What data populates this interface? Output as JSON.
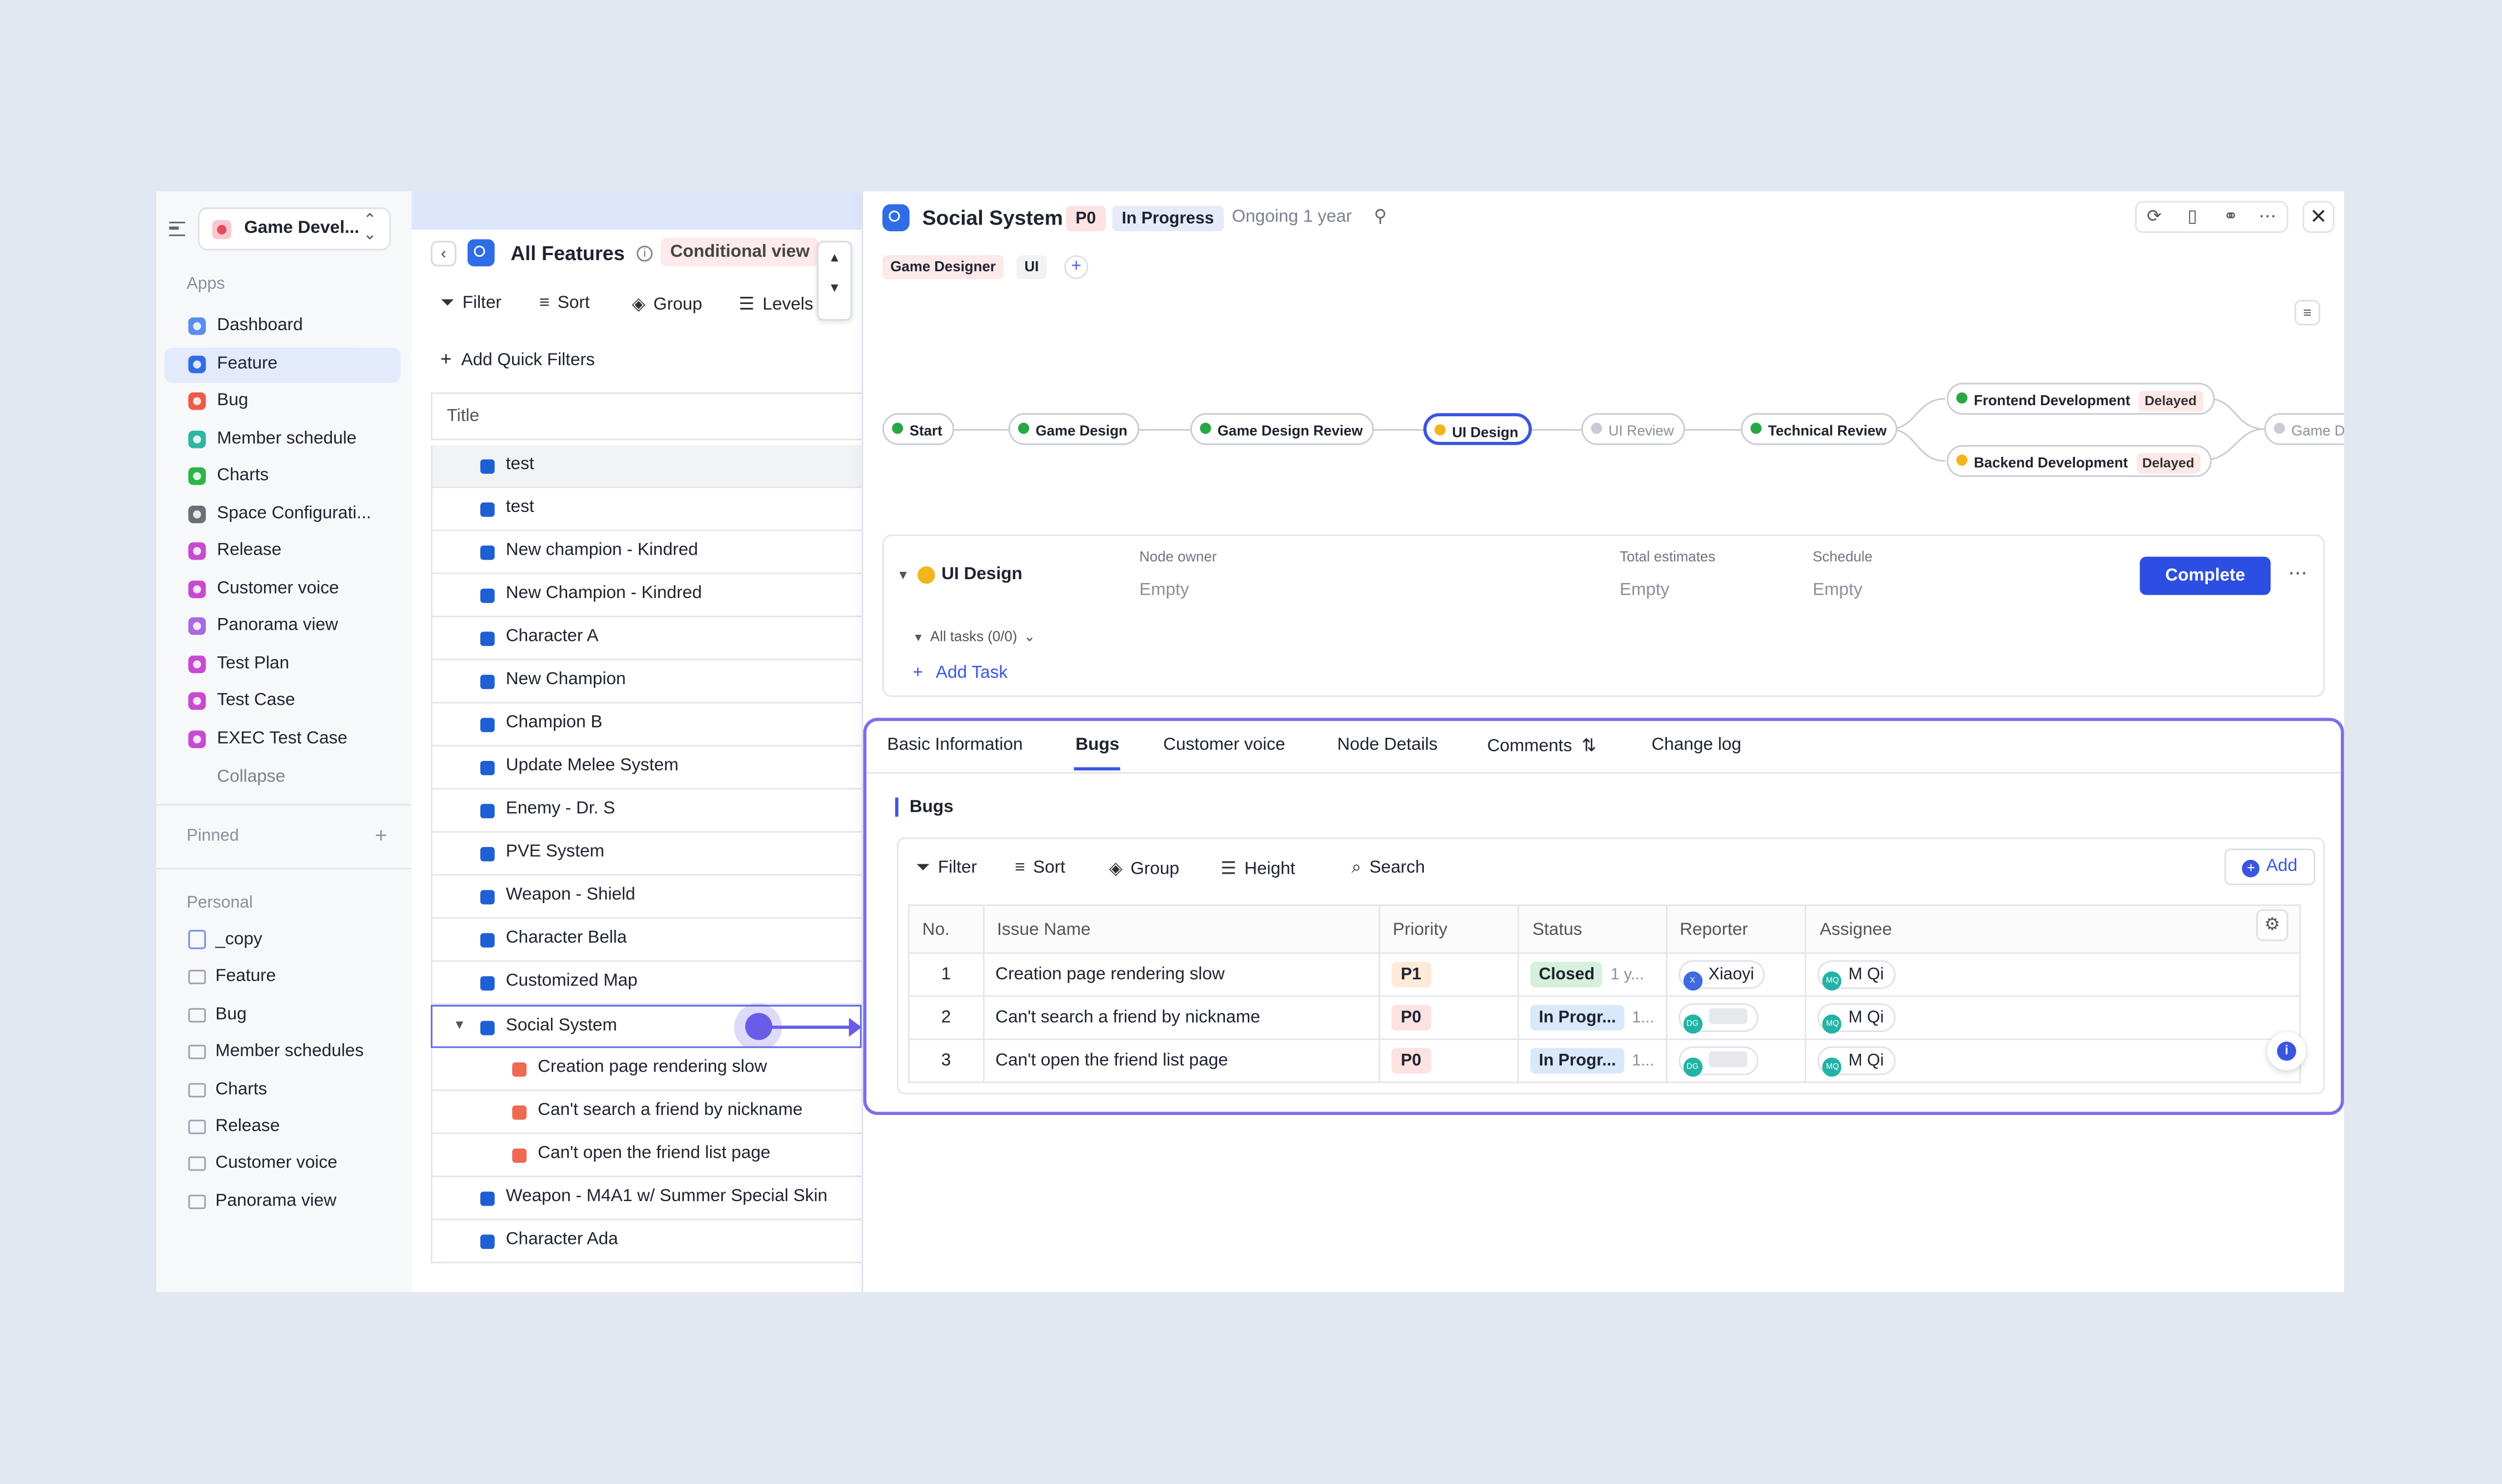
{
  "workspace": {
    "name": "Game Devel..."
  },
  "sidebar": {
    "apps_title": "Apps",
    "apps": [
      {
        "label": "Dashboard",
        "color": "#5b8def"
      },
      {
        "label": "Feature",
        "color": "#2f6de6",
        "active": true
      },
      {
        "label": "Bug",
        "color": "#ee5a4a"
      },
      {
        "label": "Member schedule",
        "color": "#2fb6a3"
      },
      {
        "label": "Charts",
        "color": "#2fb34b"
      },
      {
        "label": "Space Configurati...",
        "color": "#6b6f78"
      },
      {
        "label": "Release",
        "color": "#c64bd0"
      },
      {
        "label": "Customer voice",
        "color": "#c64bd0"
      },
      {
        "label": "Panorama view",
        "color": "#a76ae0"
      },
      {
        "label": "Test Plan",
        "color": "#c64bd0"
      },
      {
        "label": "Test Case",
        "color": "#c64bd0"
      },
      {
        "label": "EXEC Test Case",
        "color": "#c64bd0"
      }
    ],
    "collapse_label": "Collapse",
    "pinned_title": "Pinned",
    "personal_title": "Personal",
    "personal": [
      {
        "label": "_copy",
        "icon": "doc-icon"
      },
      {
        "label": "Feature",
        "icon": "folder-icon"
      },
      {
        "label": "Bug",
        "icon": "folder-icon"
      },
      {
        "label": "Member schedules",
        "icon": "folder-icon"
      },
      {
        "label": "Charts",
        "icon": "folder-icon"
      },
      {
        "label": "Release",
        "icon": "folder-icon"
      },
      {
        "label": "Customer voice",
        "icon": "folder-icon"
      },
      {
        "label": "Panorama view",
        "icon": "folder-icon"
      }
    ]
  },
  "list": {
    "title": "All Features",
    "view_badge": "Conditional view",
    "toolbar": {
      "filter": "Filter",
      "sort": "Sort",
      "group": "Group",
      "levels": "Levels"
    },
    "quick_filters": "Add Quick Filters",
    "column_title": "Title",
    "rows": [
      {
        "label": "test",
        "type": "feature"
      },
      {
        "label": "test",
        "type": "feature"
      },
      {
        "label": "New champion - Kindred",
        "type": "feature"
      },
      {
        "label": "New Champion - Kindred",
        "type": "feature"
      },
      {
        "label": "Character A",
        "type": "feature"
      },
      {
        "label": "New Champion",
        "type": "feature"
      },
      {
        "label": "Champion B",
        "type": "feature"
      },
      {
        "label": "Update Melee System",
        "type": "feature"
      },
      {
        "label": "Enemy - Dr. S",
        "type": "feature"
      },
      {
        "label": "PVE System",
        "type": "feature"
      },
      {
        "label": "Weapon - Shield",
        "type": "feature"
      },
      {
        "label": "Character Bella",
        "type": "feature"
      },
      {
        "label": "Customized Map",
        "type": "feature"
      },
      {
        "label": "Social System",
        "type": "feature",
        "selected": true
      },
      {
        "label": "Creation page rendering slow",
        "type": "bug"
      },
      {
        "label": "Can't search a friend by nickname",
        "type": "bug"
      },
      {
        "label": "Can't open the friend list page",
        "type": "bug"
      },
      {
        "label": "Weapon - M4A1 w/ Summer Special Skin",
        "type": "feature"
      },
      {
        "label": "Character Ada",
        "type": "feature"
      }
    ]
  },
  "detail": {
    "title": "Social System",
    "priority": "P0",
    "status": "In Progress",
    "duration": "Ongoing 1 year",
    "tags": [
      "Game Designer",
      "UI"
    ],
    "workflow": [
      {
        "label": "Start",
        "state": "done"
      },
      {
        "label": "Game Design",
        "state": "done"
      },
      {
        "label": "Game Design Review",
        "state": "done"
      },
      {
        "label": "UI Design",
        "state": "current"
      },
      {
        "label": "UI Review",
        "state": "pending"
      },
      {
        "label": "Technical Review",
        "state": "done"
      },
      {
        "label": "Frontend Development",
        "state": "done",
        "flag": "Delayed"
      },
      {
        "label": "Backend Development",
        "state": "current",
        "flag": "Delayed"
      },
      {
        "label": "Game D",
        "state": "pending"
      }
    ],
    "node": {
      "name": "UI Design",
      "owner_label": "Node owner",
      "owner_value": "Empty",
      "estimates_label": "Total estimates",
      "estimates_value": "Empty",
      "schedule_label": "Schedule",
      "schedule_value": "Empty",
      "complete_label": "Complete",
      "all_tasks": "All tasks (0/0)",
      "add_task": "Add Task"
    },
    "tabs": [
      "Basic Information",
      "Bugs",
      "Customer voice",
      "Node Details",
      "Comments",
      "Change log"
    ],
    "active_tab": "Bugs",
    "bugs": {
      "heading": "Bugs",
      "toolbar": {
        "filter": "Filter",
        "sort": "Sort",
        "group": "Group",
        "height": "Height",
        "search": "Search",
        "add": "Add"
      },
      "columns": [
        "No.",
        "Issue Name",
        "Priority",
        "Status",
        "Reporter",
        "Assignee"
      ],
      "rows": [
        {
          "no": "1",
          "name": "Creation page rendering slow",
          "priority": "P1",
          "status": "Closed",
          "status_extra": "1 y...",
          "reporter": "Xiaoyi",
          "reporter_initials": "X",
          "assignee": "M Qi",
          "assignee_initials": "MQ"
        },
        {
          "no": "2",
          "name": "Can't search a friend by nickname",
          "priority": "P0",
          "status": "In Progr...",
          "status_extra": "1...",
          "reporter": "",
          "reporter_initials": "DG",
          "assignee": "M Qi",
          "assignee_initials": "MQ"
        },
        {
          "no": "3",
          "name": "Can't open the friend list page",
          "priority": "P0",
          "status": "In Progr...",
          "status_extra": "1...",
          "reporter": "",
          "reporter_initials": "DG",
          "assignee": "M Qi",
          "assignee_initials": "MQ"
        }
      ]
    }
  }
}
